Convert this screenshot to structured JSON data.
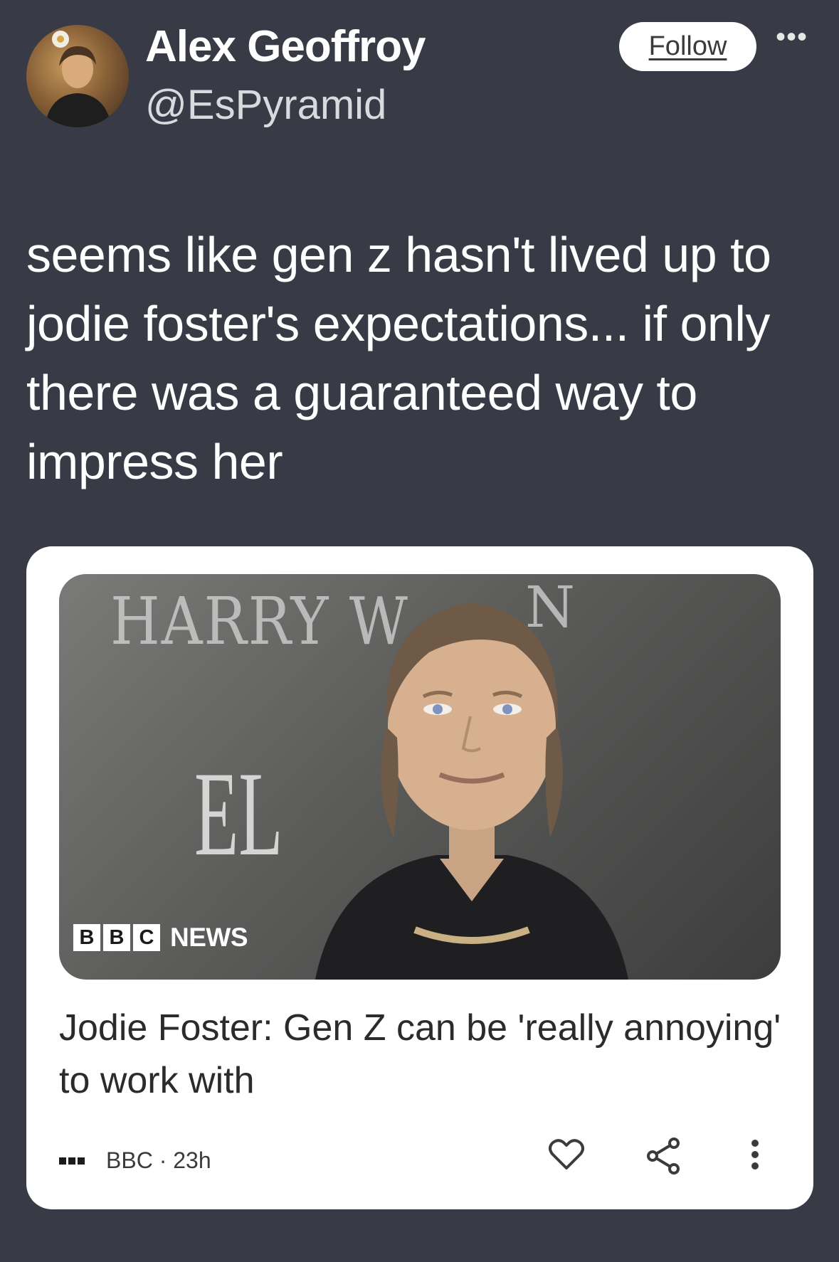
{
  "author": {
    "display_name": "Alex Geoffroy",
    "handle": "@EsPyramid",
    "avatar": "profile-photo"
  },
  "actions": {
    "follow_label": "Follow",
    "more_label": "•••"
  },
  "tweet": {
    "text": "seems like gen z hasn't lived up to jodie foster's expectations... if only there was a guaranteed way to impress her"
  },
  "news_card": {
    "image": {
      "background_text_top": "HARRY W",
      "background_text_top_right": "N",
      "background_text_large": "EL",
      "logo_letters": [
        "B",
        "B",
        "C"
      ],
      "logo_word": "NEWS"
    },
    "headline": "Jodie Foster: Gen Z can be 'really annoying' to work with",
    "source": "BBC · 23h",
    "icons": [
      "source-icon",
      "heart-icon",
      "share-icon",
      "more-vertical-icon"
    ]
  },
  "colors": {
    "background": "#383a45",
    "card": "#ffffff",
    "headline": "#2b2b2b"
  }
}
